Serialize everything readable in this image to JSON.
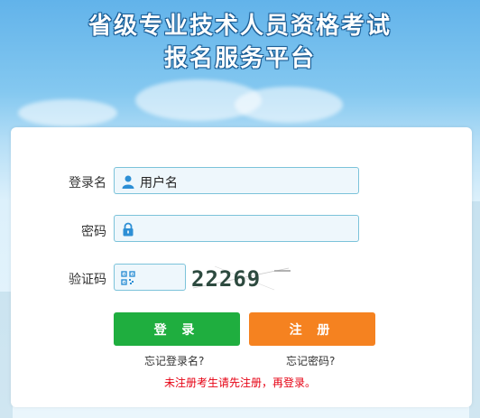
{
  "header": {
    "title_line1": "省级专业技术人员资格考试",
    "title_line2": "报名服务平台"
  },
  "form": {
    "username_label": "登录名",
    "username_value": "用户名",
    "password_label": "密码",
    "password_value": "",
    "captcha_label": "验证码",
    "captcha_value": "",
    "captcha_image_text": "22269"
  },
  "buttons": {
    "login_label": "登 录",
    "register_label": "注 册"
  },
  "links": {
    "forgot_username": "忘记登录名?",
    "forgot_password": "忘记密码?"
  },
  "notice": "未注册考生请先注册，再登录。",
  "colors": {
    "login_button": "#1fae3f",
    "register_button": "#f58220",
    "notice_text": "#e60012",
    "field_border": "#7cc3da",
    "icon_blue": "#2d8fd5"
  }
}
